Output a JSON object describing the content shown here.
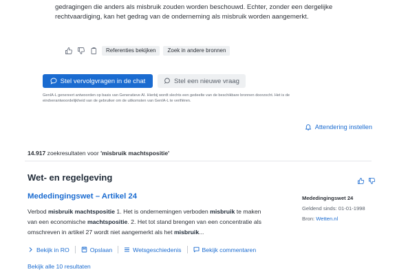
{
  "answer": {
    "lines": [
      "gedragingen die anders als misbruik zouden worden beschouwd. Echter, zonder een dergelijke",
      "rechtvaardiging, kan het gedrag van de onderneming als misbruik worden aangemerkt."
    ]
  },
  "feedback": {
    "references_label": "Referenties bekijken",
    "search_other_label": "Zoek in andere bronnen"
  },
  "followup": {
    "chat_label": "Stel vervolgvragen in de chat",
    "new_question_label": "Stel een nieuwe vraag"
  },
  "disclaimer": {
    "line1": "GenIA-L genereert antwoorden op basis van Generatieve AI. Hierbij wordt slechts een gedeelte van de beschikbare bronnen doorzocht. Het is de",
    "line2": "eindverantwoordelijkheid van de gebruiker om de uitkomsten van GenIA-L te verifiëren."
  },
  "notify_label": "Attendering instellen",
  "results": {
    "count": "14.917",
    "text": " zoekresultaten voor ",
    "query": "'misbruik machtspositie'"
  },
  "section": {
    "title": "Wet- en regelgeving"
  },
  "document": {
    "title": "Mededingingswet – Artikel 24",
    "snippet": {
      "l1_a": "Verbod ",
      "l1_b": "misbruik machtspositie",
      "l1_c": " 1. Het is ondernemingen verboden ",
      "l1_d": "misbruik",
      "l1_e": " te maken",
      "l2_a": "van een economische ",
      "l2_b": "machtspositie",
      "l2_c": ". 2. Het tot stand brengen van een concentratie als",
      "l3_a": "omschreven in artikel 27 wordt niet aangemerkt als het ",
      "l3_b": "misbruik",
      "l3_c": "..."
    },
    "actions": {
      "view_ro": "Bekijk in RO",
      "save": "Opslaan",
      "history": "Wetsgeschiedenis",
      "comments": "Bekijk commentaren"
    },
    "meta": {
      "title": "Mededingingswet 24",
      "valid_since": "Geldend sinds: 01-01-1998",
      "source_label": "Bron: ",
      "source_name": "Wetten.nl"
    }
  },
  "view_all_label": "Bekijk alle 10 resultaten",
  "icons": {
    "thumb_up": "thumbs-up-icon",
    "thumb_down": "thumbs-down-icon",
    "copy": "copy-icon",
    "chat": "chat-bubble-icon",
    "search": "search-icon",
    "bell": "bell-icon",
    "chevron": "chevron-right-icon",
    "bookmark": "bookmark-icon",
    "list": "list-icon",
    "comment": "comment-icon"
  },
  "colors": {
    "accent": "#1a6bd0",
    "text": "#1f2a37",
    "muted": "#59606a",
    "pill_bg": "#eef0f2"
  }
}
